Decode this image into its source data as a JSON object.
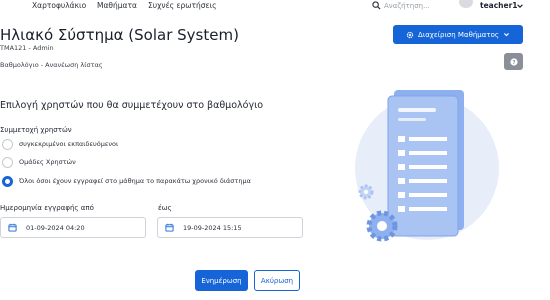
{
  "nav": {
    "items": [
      "Χαρτοφυλάκιο",
      "Μαθήματα",
      "Συχνές ερωτήσεις"
    ],
    "search_placeholder": "Αναζήτηση...",
    "username": "teacher1"
  },
  "header": {
    "title": "Ηλιακό Σύστημα (Solar System)",
    "course_code": "TMA121 - Admin",
    "breadcrumb": "Βαθμολόγιο - Ανανέωση λίστας",
    "manage_button": "Διαχείριση Μαθήματος"
  },
  "section": {
    "title": "Επιλογή χρηστών που θα συμμετέχουν στο βαθμολόγιο",
    "participation_label": "Συμμετοχή χρηστών",
    "options": [
      {
        "label": "συγκεκριμένοι εκπαιδευόμενοι",
        "selected": false
      },
      {
        "label": "Ομάδες Χρηστών",
        "selected": false
      },
      {
        "label": "Όλοι όσοι έχουν εγγραφεί στο μάθημα το παρακάτω χρονικό διάστημα",
        "selected": true
      }
    ]
  },
  "dates": {
    "from_label": "Ημερομηνία εγγραφής από",
    "from_value": "01-09-2024 04:20",
    "to_label": "έως",
    "to_value": "19-09-2024 15:15"
  },
  "actions": {
    "update": "Ενημέρωση",
    "cancel": "Ακύρωση"
  },
  "colors": {
    "primary": "#1565d8",
    "illustration_bg": "#e8eef9",
    "illustration_doc": "#7fa4ea",
    "help_button": "#8a8f98"
  },
  "icons": [
    "search-icon",
    "avatar",
    "chevron-down-icon",
    "gear-icon",
    "help-icon",
    "calendar-icon"
  ]
}
